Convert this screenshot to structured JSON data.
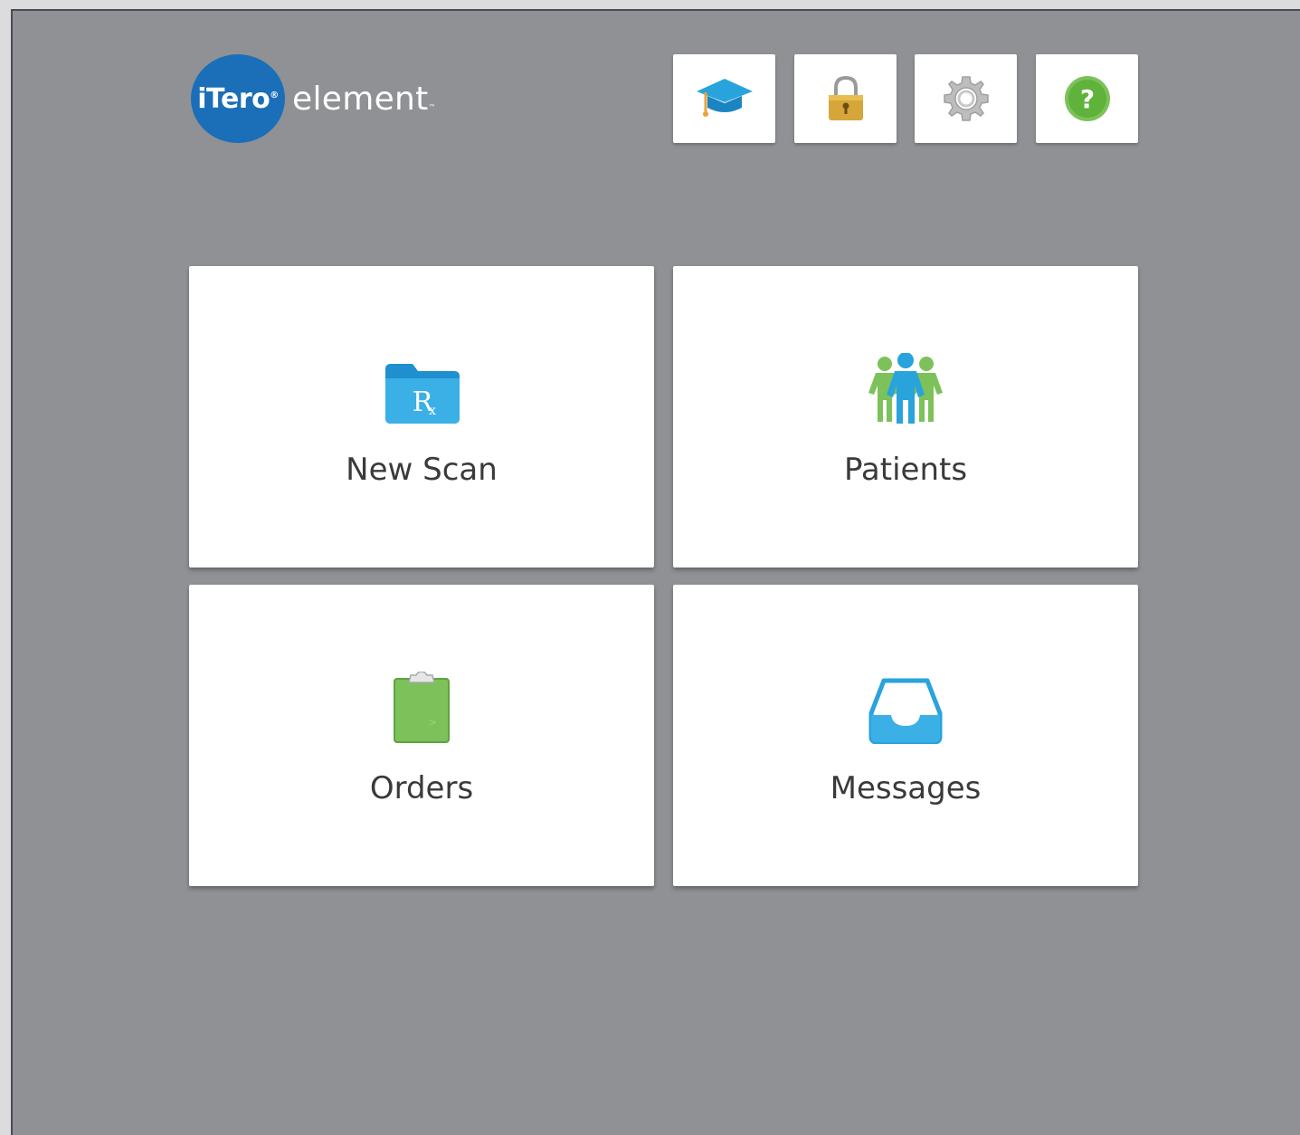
{
  "logo": {
    "brand": "iTero",
    "product": "element"
  },
  "toolbar": [
    {
      "icon": "graduation-cap-icon",
      "name": "learning-center-button"
    },
    {
      "icon": "lock-icon",
      "name": "lock-button"
    },
    {
      "icon": "gear-icon",
      "name": "settings-button"
    },
    {
      "icon": "help-icon",
      "name": "help-button"
    }
  ],
  "tiles": {
    "new_scan": {
      "label": "New Scan",
      "icon": "rx-folder-icon"
    },
    "patients": {
      "label": "Patients",
      "icon": "people-icon"
    },
    "orders": {
      "label": "Orders",
      "icon": "clipboard-icon"
    },
    "messages": {
      "label": "Messages",
      "icon": "inbox-tray-icon"
    }
  },
  "colors": {
    "background": "#8f9194",
    "logo_blue": "#1a6fb8",
    "icon_blue": "#29a3dc",
    "icon_green": "#7cc15a",
    "lock_gold": "#d7a63a"
  }
}
